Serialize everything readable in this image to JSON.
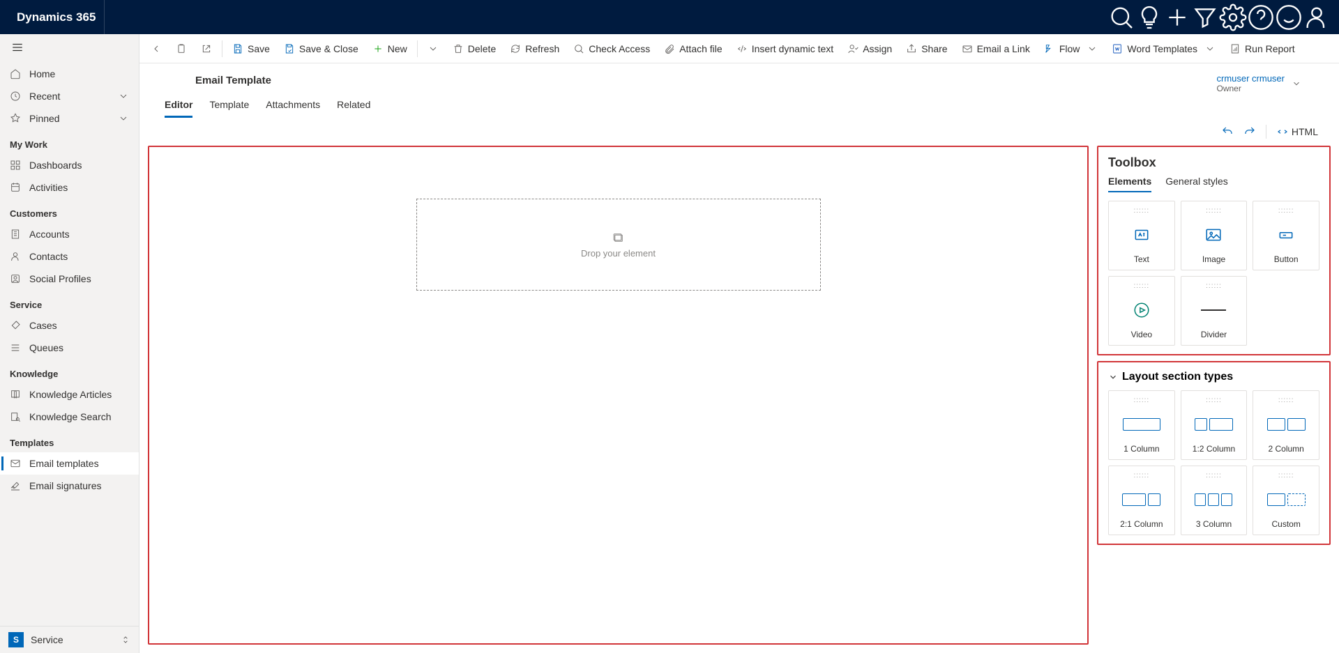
{
  "brand": "Dynamics 365",
  "sidebar": {
    "top": [
      {
        "label": "Home"
      },
      {
        "label": "Recent",
        "expandable": true
      },
      {
        "label": "Pinned",
        "expandable": true
      }
    ],
    "sections": [
      {
        "label": "My Work",
        "items": [
          "Dashboards",
          "Activities"
        ]
      },
      {
        "label": "Customers",
        "items": [
          "Accounts",
          "Contacts",
          "Social Profiles"
        ]
      },
      {
        "label": "Service",
        "items": [
          "Cases",
          "Queues"
        ]
      },
      {
        "label": "Knowledge",
        "items": [
          "Knowledge Articles",
          "Knowledge Search"
        ]
      },
      {
        "label": "Templates",
        "items": [
          "Email templates",
          "Email signatures"
        ],
        "activeIndex": 0
      }
    ],
    "area": {
      "badge": "S",
      "label": "Service"
    }
  },
  "cmd": {
    "save": "Save",
    "saveClose": "Save & Close",
    "new": "New",
    "delete": "Delete",
    "refresh": "Refresh",
    "checkAccess": "Check Access",
    "attach": "Attach file",
    "insertDyn": "Insert dynamic text",
    "assign": "Assign",
    "share": "Share",
    "emailLink": "Email a Link",
    "flow": "Flow",
    "wordTmpl": "Word Templates",
    "runReport": "Run Report"
  },
  "record": {
    "entity": "Email Template",
    "owner": {
      "name": "crmuser crmuser",
      "label": "Owner"
    },
    "tabs": [
      "Editor",
      "Template",
      "Attachments",
      "Related"
    ],
    "activeTab": 0,
    "htmlBtn": "HTML"
  },
  "canvas": {
    "drop": "Drop your element"
  },
  "toolbox": {
    "title": "Toolbox",
    "tabs": [
      "Elements",
      "General styles"
    ],
    "activeTab": 0,
    "elements": [
      "Text",
      "Image",
      "Button",
      "Video",
      "Divider"
    ],
    "layoutTitle": "Layout section types",
    "layouts": [
      "1 Column",
      "1:2 Column",
      "2 Column",
      "2:1 Column",
      "3 Column",
      "Custom"
    ]
  }
}
